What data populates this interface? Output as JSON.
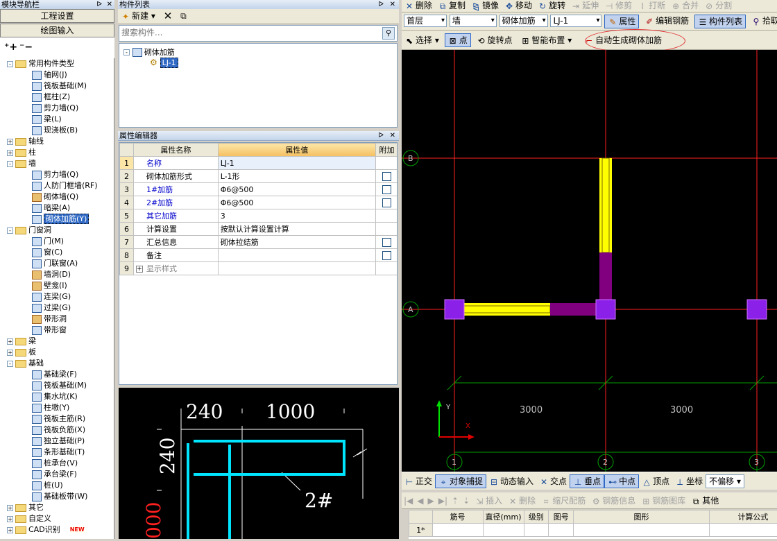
{
  "nav": {
    "title": "模块导航栏",
    "pin": "ᐅ",
    "close": "✕",
    "btn_settings": "工程设置",
    "btn_draw": "绘图输入",
    "tree": [
      {
        "level": 0,
        "type": "folder",
        "exp": "-",
        "label": "常用构件类型"
      },
      {
        "level": 1,
        "type": "item",
        "label": "轴网(J)"
      },
      {
        "level": 1,
        "type": "item",
        "label": "筏板基础(M)"
      },
      {
        "level": 1,
        "type": "item",
        "label": "框柱(Z)"
      },
      {
        "level": 1,
        "type": "item",
        "label": "剪力墙(Q)"
      },
      {
        "level": 1,
        "type": "item",
        "label": "梁(L)"
      },
      {
        "level": 1,
        "type": "item",
        "label": "现浇板(B)"
      },
      {
        "level": 0,
        "type": "folder",
        "exp": "+",
        "label": "轴线"
      },
      {
        "level": 0,
        "type": "folder",
        "exp": "+",
        "label": "柱"
      },
      {
        "level": 0,
        "type": "folder",
        "exp": "-",
        "label": "墙"
      },
      {
        "level": 1,
        "type": "item",
        "label": "剪力墙(Q)"
      },
      {
        "level": 1,
        "type": "item",
        "label": "人防门框墙(RF)"
      },
      {
        "level": 1,
        "type": "wall",
        "label": "砌体墙(Q)"
      },
      {
        "level": 1,
        "type": "item",
        "label": "暗梁(A)"
      },
      {
        "level": 1,
        "type": "item",
        "label": "砌体加筋(Y)",
        "selected": true
      },
      {
        "level": 0,
        "type": "folder",
        "exp": "-",
        "label": "门窗洞"
      },
      {
        "level": 1,
        "type": "item",
        "label": "门(M)"
      },
      {
        "level": 1,
        "type": "item",
        "label": "窗(C)"
      },
      {
        "level": 1,
        "type": "item",
        "label": "门联窗(A)"
      },
      {
        "level": 1,
        "type": "wall",
        "label": "墙洞(D)"
      },
      {
        "level": 1,
        "type": "wall",
        "label": "壁龛(I)"
      },
      {
        "level": 1,
        "type": "item",
        "label": "连梁(G)"
      },
      {
        "level": 1,
        "type": "item",
        "label": "过梁(G)"
      },
      {
        "level": 1,
        "type": "wall",
        "label": "带形洞"
      },
      {
        "level": 1,
        "type": "item",
        "label": "带形窗"
      },
      {
        "level": 0,
        "type": "folder",
        "exp": "+",
        "label": "梁"
      },
      {
        "level": 0,
        "type": "folder",
        "exp": "+",
        "label": "板"
      },
      {
        "level": 0,
        "type": "folder",
        "exp": "-",
        "label": "基础"
      },
      {
        "level": 1,
        "type": "item",
        "label": "基础梁(F)"
      },
      {
        "level": 1,
        "type": "item",
        "label": "筏板基础(M)"
      },
      {
        "level": 1,
        "type": "item",
        "label": "集水坑(K)"
      },
      {
        "level": 1,
        "type": "item",
        "label": "柱墩(Y)"
      },
      {
        "level": 1,
        "type": "item",
        "label": "筏板主筋(R)"
      },
      {
        "level": 1,
        "type": "item",
        "label": "筏板负筋(X)"
      },
      {
        "level": 1,
        "type": "item",
        "label": "独立基础(P)"
      },
      {
        "level": 1,
        "type": "item",
        "label": "条形基础(T)"
      },
      {
        "level": 1,
        "type": "item",
        "label": "桩承台(V)"
      },
      {
        "level": 1,
        "type": "item",
        "label": "承台梁(F)"
      },
      {
        "level": 1,
        "type": "item",
        "label": "桩(U)"
      },
      {
        "level": 1,
        "type": "item",
        "label": "基础板带(W)"
      },
      {
        "level": 0,
        "type": "folder",
        "exp": "+",
        "label": "其它"
      },
      {
        "level": 0,
        "type": "folder",
        "exp": "+",
        "label": "自定义"
      },
      {
        "level": 0,
        "type": "folder",
        "exp": "+",
        "label": "CAD识别",
        "badge": "NEW"
      }
    ]
  },
  "comp_list": {
    "title": "构件列表",
    "new_label": "新建",
    "search_placeholder": "搜索构件...",
    "root": "砌体加筋",
    "child": "LJ-1"
  },
  "prop_editor": {
    "title": "属性编辑器",
    "headers": [
      "属性名称",
      "属性值",
      "附加"
    ],
    "rows": [
      {
        "n": "1",
        "name": "名称",
        "value": "LJ-1",
        "blue": true,
        "chk": false,
        "sel": true
      },
      {
        "n": "2",
        "name": "砌体加筋形式",
        "value": "L-1形",
        "blue": false,
        "chk": true
      },
      {
        "n": "3",
        "name": "1#加筋",
        "value": "Φ6@500",
        "blue": true,
        "chk": true
      },
      {
        "n": "4",
        "name": "2#加筋",
        "value": "Φ6@500",
        "blue": true,
        "chk": true
      },
      {
        "n": "5",
        "name": "其它加筋",
        "value": "3",
        "blue": true,
        "chk": false
      },
      {
        "n": "6",
        "name": "计算设置",
        "value": "按默认计算设置计算",
        "blue": false,
        "chk": false
      },
      {
        "n": "7",
        "name": "汇总信息",
        "value": "砌体拉结筋",
        "blue": false,
        "chk": true
      },
      {
        "n": "8",
        "name": "备注",
        "value": "",
        "blue": false,
        "chk": true
      },
      {
        "n": "9",
        "name": "显示样式",
        "value": "",
        "blue": false,
        "chk": false,
        "gray": true
      }
    ]
  },
  "preview": {
    "dim1": "240",
    "dim2": "1000",
    "dim3": "240",
    "bar_label": "2#",
    "dim4": "000"
  },
  "toolbar1": [
    "删除",
    "复制",
    "镜像",
    "移动",
    "旋转",
    "延伸",
    "修剪",
    "打断",
    "合并",
    "分割"
  ],
  "toolbar2": {
    "floor": "首层",
    "type": "墙",
    "category": "砌体加筋",
    "comp": "LJ-1",
    "btn_props": "属性",
    "btn_edit_rebar": "编辑钢筋",
    "btn_comp_list": "构件列表",
    "btn_pick": "拾取构"
  },
  "toolbar3": {
    "select": "选择",
    "point": "点",
    "rotate_point": "旋转点",
    "smart": "智能布置",
    "auto_gen": "自动生成砌体加筋"
  },
  "canvas": {
    "axis_b": "B",
    "axis_a": "A",
    "axis_1": "1",
    "axis_2": "2",
    "axis_3": "3",
    "dim_left": "3000",
    "dim_right": "3000",
    "ucs_y": "Y",
    "ucs_x": "X"
  },
  "snapbar": [
    "正交",
    "对象捕捉",
    "动态输入",
    "交点",
    "垂点",
    "中点",
    "顶点",
    "坐标",
    "不偏移"
  ],
  "rebar_toolbar": [
    "插入",
    "删除",
    "缩尺配筋",
    "钢筋信息",
    "钢筋图库",
    "其他"
  ],
  "rebar_table": {
    "headers": [
      "筋号",
      "直径(mm)",
      "级别",
      "图号",
      "图形",
      "计算公式"
    ],
    "row1": "1*"
  },
  "colors": {
    "canvas_bg": "#000000",
    "axis_red": "#ff2020",
    "grid_green": "#00a000",
    "rebar_yellow": "#ffff00",
    "rebar_purple": "#800080",
    "column_violet": "#8b20e8",
    "highlight_circle": "#e03030"
  }
}
